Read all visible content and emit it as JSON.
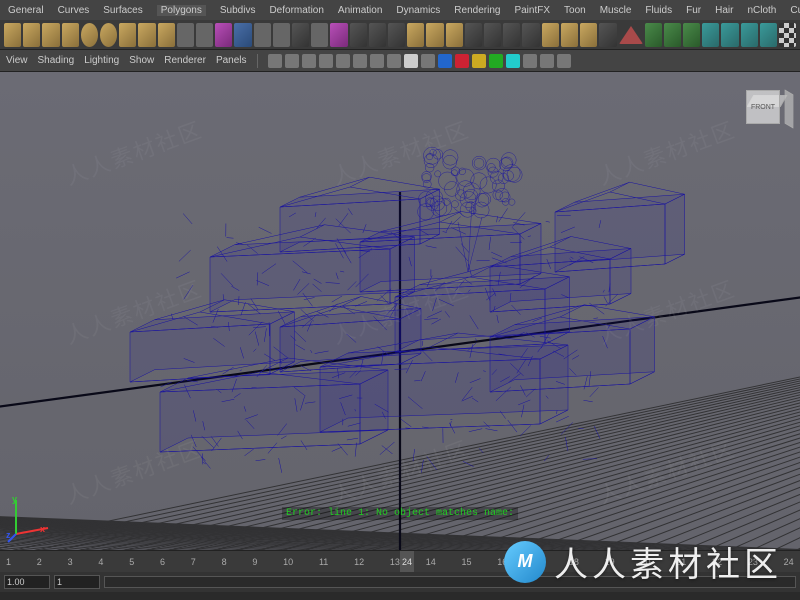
{
  "menubar": [
    "General",
    "Curves",
    "Surfaces",
    "Polygons",
    "Subdivs",
    "Deformation",
    "Animation",
    "Dynamics",
    "Rendering",
    "PaintFX",
    "Toon",
    "Muscle",
    "Fluids",
    "Fur",
    "Hair",
    "nCloth",
    "Custom"
  ],
  "panel_menu": [
    "View",
    "Shading",
    "Lighting",
    "Show",
    "Renderer",
    "Panels"
  ],
  "viewcube_face": "FRONT",
  "axis": {
    "x": "x",
    "y": "y",
    "z": "z"
  },
  "status_text": "Error: line 1: No object matches name: ",
  "timeline": {
    "ticks": [
      "1",
      "2",
      "3",
      "4",
      "5",
      "6",
      "7",
      "8",
      "9",
      "10",
      "11",
      "12",
      "13",
      "14",
      "15",
      "16",
      "17",
      "18",
      "19",
      "20",
      "21",
      "22",
      "23",
      "24"
    ],
    "current": "24",
    "range_start": "1.00",
    "range_end": "1"
  },
  "watermark": {
    "logo_text": "M",
    "label": "人人素材社区"
  },
  "tile_watermark": "人人素材社区",
  "icons": {
    "cubes": [
      "cube",
      "cube",
      "cube",
      "cube",
      "torus",
      "torus",
      "cube",
      "cube",
      "cube"
    ],
    "mid": [
      "gray",
      "gray",
      "magenta",
      "blue",
      "gray",
      "gray",
      "dark",
      "gray"
    ],
    "tools": [
      "magenta",
      "dark",
      "dark",
      "dark",
      "cube",
      "cube",
      "cube",
      "dark",
      "dark",
      "dark",
      "dark",
      "cube",
      "cube",
      "cube",
      "dark",
      "tri",
      "green",
      "green",
      "green",
      "cyan",
      "cyan",
      "cyan",
      "cyan",
      "checker"
    ]
  }
}
